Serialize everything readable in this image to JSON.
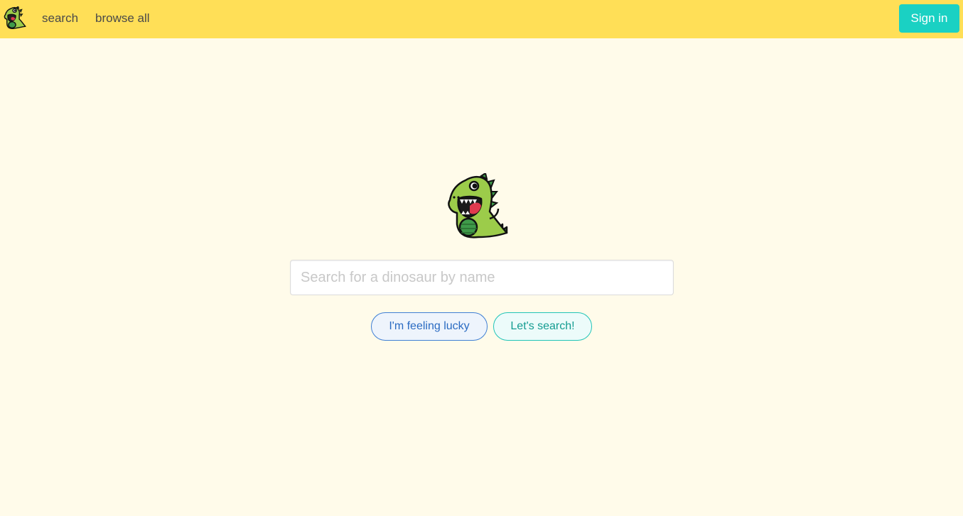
{
  "navbar": {
    "logo_icon": "dinosaur-logo-icon",
    "links": {
      "search": "search",
      "browse_all": "browse all"
    },
    "signin_label": "Sign in"
  },
  "main": {
    "hero_icon": "dinosaur-mascot-icon",
    "search": {
      "placeholder": "Search for a dinosaur by name",
      "value": ""
    },
    "buttons": {
      "lucky_label": "I'm feeling lucky",
      "search_label": "Let's search!"
    }
  },
  "colors": {
    "navbar_bg": "#ffdf57",
    "page_bg": "#fffbea",
    "signin_bg": "#1ad1c3",
    "lucky_accent": "#3e7ed4",
    "search_accent": "#1fc4b7",
    "dino_green": "#9ccc4a"
  }
}
